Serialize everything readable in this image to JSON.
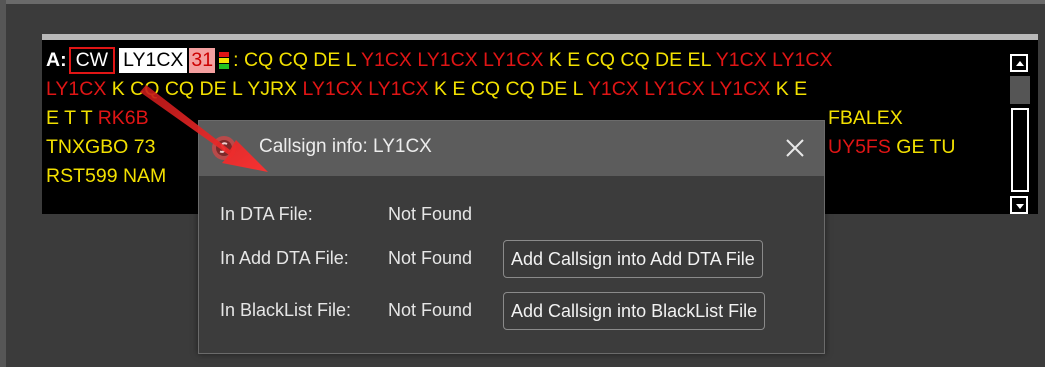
{
  "decode": {
    "mode_prefix": "A:",
    "mode": "CW",
    "callsign": "LY1CX",
    "snr": "31",
    "meter_colors": [
      "#e01515",
      "#f2e000",
      "#22c022"
    ],
    "line1": [
      {
        "t": "y",
        "s": ": CQ CQ DE L "
      },
      {
        "t": "r",
        "s": "Y1CX LY1CX LY1CX"
      },
      {
        "t": "y",
        "s": " K E CQ CQ DE EL "
      },
      {
        "t": "r",
        "s": "Y1CX LY1CX"
      }
    ],
    "line2": [
      {
        "t": "r",
        "s": "LY1CX"
      },
      {
        "t": "y",
        "s": " K CQ CQ DE L YJRX "
      },
      {
        "t": "r",
        "s": "LY1CX LY1CX"
      },
      {
        "t": "y",
        "s": " K E CQ CQ DE L "
      },
      {
        "t": "r",
        "s": "Y1CX LY1CX LY1CX"
      },
      {
        "t": "y",
        "s": " K E"
      }
    ],
    "line3_left": [
      {
        "t": "y",
        "s": "E T T "
      },
      {
        "t": "r",
        "s": "RK6B"
      }
    ],
    "line3_right": [
      {
        "t": "y",
        "s": "FBALEX"
      }
    ],
    "line4_left": [
      {
        "t": "y",
        "s": "TNXGBO 73"
      }
    ],
    "line4_right": [
      {
        "t": "r",
        "s": "UY5FS"
      },
      {
        "t": "y",
        "s": " GE TU"
      }
    ],
    "line5_left": [
      {
        "t": "y",
        "s": "RST599 NAM"
      }
    ]
  },
  "scrollbar": {
    "up_icon": "scroll-up-arrow-icon",
    "down_icon": "scroll-down-arrow-icon"
  },
  "dialog": {
    "title": "Callsign info: LY1CX",
    "app_icon": "app-logo-icon",
    "close_icon": "close-icon",
    "rows": [
      {
        "label": "In DTA File:",
        "value": "Not Found"
      },
      {
        "label": "In Add DTA File:",
        "value": "Not Found",
        "button": "Add Callsign into Add DTA File"
      },
      {
        "label": "In BlackList File:",
        "value": "Not Found",
        "button": "Add Callsign into BlackList File"
      }
    ]
  },
  "annotation": {
    "arrow_color": "#d82020"
  }
}
